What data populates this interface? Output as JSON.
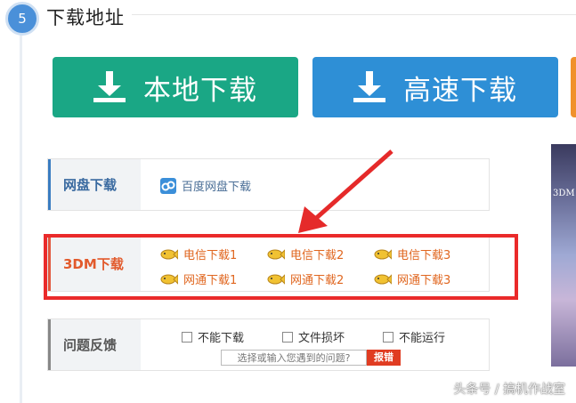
{
  "section": {
    "step_number": "5",
    "title": "下载地址"
  },
  "buttons": {
    "local_download": "本地下载",
    "fast_download": "高速下载"
  },
  "netdisk": {
    "label": "网盘下载",
    "link": "百度网盘下载"
  },
  "mirrors": {
    "label": "3DM下载",
    "links": [
      "电信下载1",
      "电信下载2",
      "电信下载3",
      "网通下载1",
      "网通下载2",
      "网通下载3"
    ]
  },
  "feedback": {
    "label": "问题反馈",
    "options": [
      "不能下载",
      "文件损坏",
      "不能运行"
    ],
    "placeholder": "选择或输入您遇到的问题?",
    "submit": "报错"
  },
  "side_image_text": "3DM",
  "watermark": "头条号 / 搞机作战室",
  "colors": {
    "local": "#1aa785",
    "fast": "#2e8fd6",
    "highlight": "#ea2a2a"
  }
}
